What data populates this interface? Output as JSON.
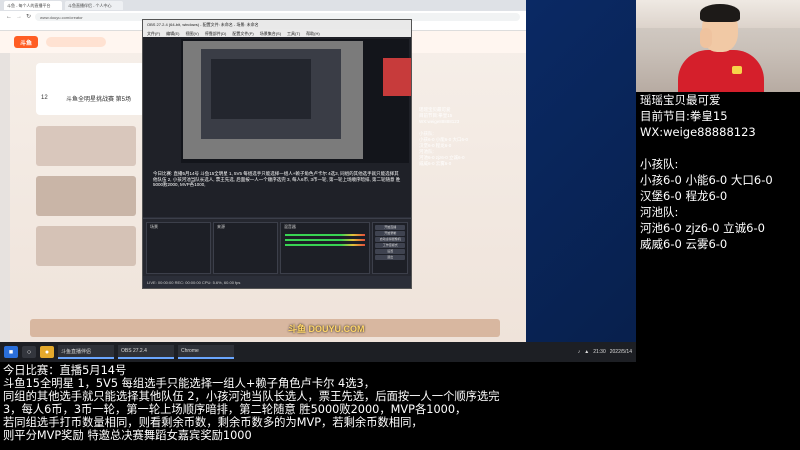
{
  "browser": {
    "tabs": [
      "斗鱼 - 每个人的直播平台",
      "斗鱼直播伴侣 - 个人中心"
    ],
    "url": "www.douyu.com/creator",
    "site_logo": "斗鱼",
    "follower_count": "12",
    "room_title": "斗鱼全明星挑战赛 第5场"
  },
  "obs": {
    "title": "OBS 27.2.4 (64-bit, windows) - 配置文件: 未命名 - 场景: 未命名",
    "menu": [
      "文件(F)",
      "编辑(E)",
      "视图(V)",
      "停靠部件(D)",
      "配置文件(P)",
      "场景集合(S)",
      "工具(T)",
      "帮助(H)"
    ],
    "overlay_text": "瑶瑶宝贝最可爱\n目前节目:拳皇15\nWX:weige88888123\n\n小孩队:\n小孩6-0 小能6-0 大口6-0\n汉堡6-0 程龙6-0\n河池队:\n河池6-0 zjz6-0 立诚6-0\n威威6-0 云雾6-0",
    "description": "今日比赛: 直播5月14号\n斗鱼15全明星 1, 5V5 每组选手只能选择一组人+赖子角色卢卡尔 4选3, 同组的其他选手就只能选择其他队伍 2, 小孩河池当队长选人, 票王先选, 后面按一人一个顺序选完 3, 每人6币, 3币一轮, 第一轮上场顺序暗排, 第二轮随意 胜5000败2000, MVP各1000,",
    "docks": [
      "场景",
      "来源",
      "混音器",
      "控件"
    ],
    "controls": [
      "开始直播",
      "开始录制",
      "启动虚拟摄像机",
      "工作室模式",
      "设置",
      "退出"
    ],
    "status": "LIVE: 00:00:00   REC: 00:00:00   CPU: 5.6%, 60.00 fps"
  },
  "taskbar": {
    "tasks": [
      "斗鱼直播伴侣",
      "OBS 27.2.4",
      "Chrome"
    ],
    "clock": "21:30",
    "date": "2022/5/14"
  },
  "watermark": "斗鱼 DOUYU.COM",
  "info_panel": {
    "line1": "瑶瑶宝贝最可爱",
    "line2": "目前节目:拳皇15",
    "line3": "WX:weige88888123",
    "team_a_title": "小孩队:",
    "team_a_row1": "小孩6-0 小能6-0 大口6-0",
    "team_a_row2": "汉堡6-0 程龙6-0",
    "team_b_title": "河池队:",
    "team_b_row1": "河池6-0 zjz6-0 立诚6-0",
    "team_b_row2": "威威6-0 云雾6-0"
  },
  "rules": {
    "line1": "今日比赛：直播5月14号",
    "line2": "斗鱼15全明星 1，5V5 每组选手只能选择一组人+赖子角色卢卡尔 4选3，",
    "line3": "同组的其他选手就只能选择其他队伍 2，小孩河池当队长选人，票王先选，后面按一人一个顺序选完",
    "line4": "3，每人6币，3币一轮，第一轮上场顺序暗排，第二轮随意 胜5000败2000，MVP各1000，",
    "line5": "若同组选手打币数量相同，则看剩余币数，剩余币数多的为MVP，若剩余币数相同，",
    "line6": "则平分MVP奖励 特邀总决赛舞蹈女嘉宾奖励1000"
  },
  "colors": {
    "page_bg": "#000000",
    "desktop_bg": "#0a3d8f",
    "obs_bg": "#2b2e38",
    "jersey_red": "#d51f2b",
    "text_white": "#ffffff"
  }
}
